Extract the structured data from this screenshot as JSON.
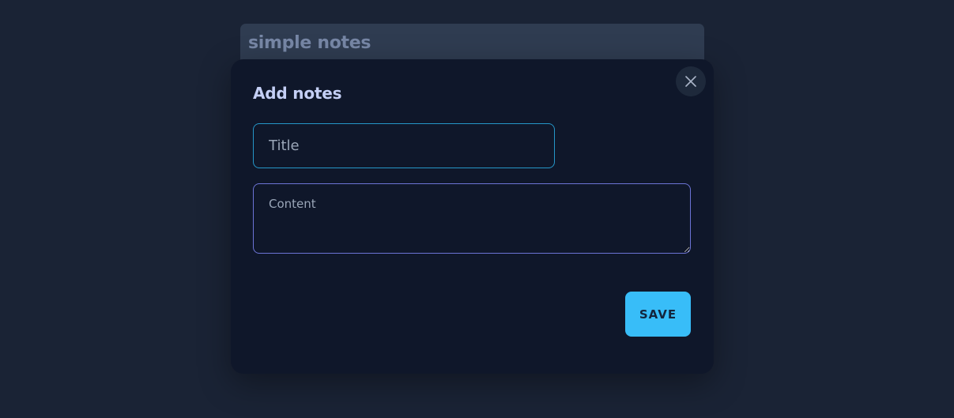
{
  "app": {
    "title": "simple notes"
  },
  "modal": {
    "title": "Add notes",
    "close_icon": "close-icon",
    "title_field": {
      "placeholder": "Title",
      "value": ""
    },
    "content_field": {
      "placeholder": "Content",
      "value": ""
    },
    "save_label": "SAVE"
  },
  "colors": {
    "background": "#1a2335",
    "modal_background": "#0f172a",
    "accent": "#38bdf8",
    "title_field_border": "#2596c8",
    "content_field_border": "#6c74d6"
  }
}
